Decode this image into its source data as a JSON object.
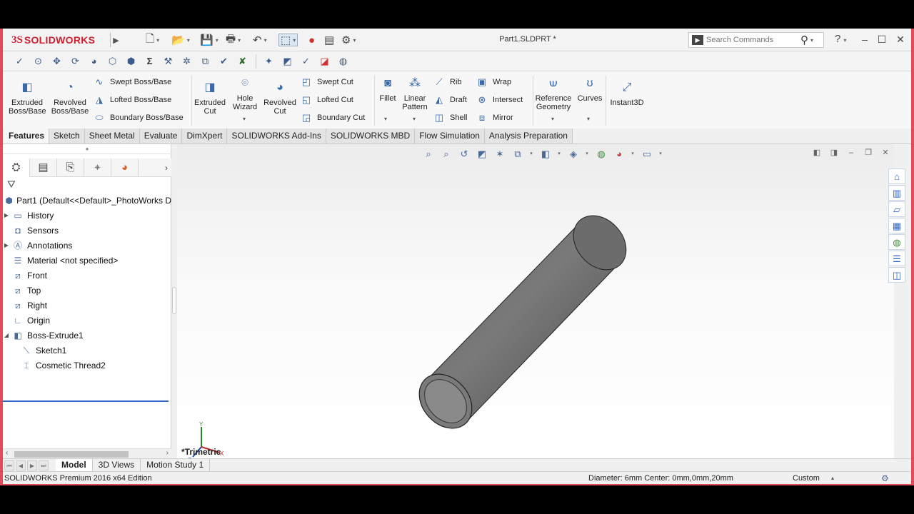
{
  "app": {
    "logo_prefix": "3S",
    "logo_text": "SOLIDWORKS",
    "document_title": "Part1.SLDPRT *",
    "search_placeholder": "Search Commands",
    "help_icon": "?",
    "window_buttons": [
      "–",
      "☐",
      "✕"
    ]
  },
  "quick_access": [
    {
      "name": "new-icon",
      "glyph": "🗋"
    },
    {
      "name": "open-icon",
      "glyph": "📂"
    },
    {
      "name": "save-icon",
      "glyph": "💾"
    },
    {
      "name": "print-icon",
      "glyph": "🖶"
    },
    {
      "name": "undo-icon",
      "glyph": "↶"
    },
    {
      "name": "select-icon",
      "glyph": "⬚"
    },
    {
      "name": "traffic-light-icon",
      "glyph": "●"
    },
    {
      "name": "options-list-icon",
      "glyph": "▤"
    },
    {
      "name": "gear-icon",
      "glyph": "⚙"
    }
  ],
  "command_manager": {
    "extruded_boss": "Extruded Boss/Base",
    "revolved_boss": "Revolved Boss/Base",
    "swept_boss": "Swept Boss/Base",
    "lofted_boss": "Lofted Boss/Base",
    "boundary_boss": "Boundary Boss/Base",
    "extruded_cut": "Extruded Cut",
    "hole_wizard": "Hole Wizard",
    "revolved_cut": "Revolved Cut",
    "swept_cut": "Swept Cut",
    "lofted_cut": "Lofted Cut",
    "boundary_cut": "Boundary Cut",
    "fillet": "Fillet",
    "linear_pattern": "Linear Pattern",
    "rib": "Rib",
    "draft": "Draft",
    "shell": "Shell",
    "wrap": "Wrap",
    "intersect": "Intersect",
    "mirror": "Mirror",
    "reference_geometry": "Reference Geometry",
    "curves": "Curves",
    "instant3d": "Instant3D"
  },
  "tabs": [
    "Features",
    "Sketch",
    "Sheet Metal",
    "Evaluate",
    "DimXpert",
    "SOLIDWORKS Add-Ins",
    "SOLIDWORKS MBD",
    "Flow Simulation",
    "Analysis Preparation"
  ],
  "tree": {
    "root": "Part1  (Default<<Default>_PhotoWorks D",
    "items": [
      {
        "label": "History",
        "icon": "history-folder-icon"
      },
      {
        "label": "Sensors",
        "icon": "sensor-icon"
      },
      {
        "label": "Annotations",
        "icon": "annotations-icon"
      },
      {
        "label": "Material <not specified>",
        "icon": "material-icon"
      },
      {
        "label": "Front",
        "icon": "plane-icon"
      },
      {
        "label": "Top",
        "icon": "plane-icon"
      },
      {
        "label": "Right",
        "icon": "plane-icon"
      },
      {
        "label": "Origin",
        "icon": "origin-icon"
      },
      {
        "label": "Boss-Extrude1",
        "icon": "extrude-feature-icon"
      },
      {
        "label": "Sketch1",
        "icon": "sketch-icon"
      },
      {
        "label": "Cosmetic Thread2",
        "icon": "cosmetic-thread-icon"
      }
    ]
  },
  "viewport": {
    "view_name": "*Trimetric",
    "triad_x": "X",
    "triad_y": "Y",
    "triad_z": "Z"
  },
  "bottom_tabs": [
    "Model",
    "3D Views",
    "Motion Study 1"
  ],
  "status": {
    "edition": "SOLIDWORKS Premium 2016 x64 Edition",
    "measurement": "Diameter: 6mm  Center: 0mm,0mm,20mm",
    "units": "Custom"
  },
  "colors": {
    "brand": "#d02030",
    "frame": "#e14b5b",
    "selection": "#2f64c8",
    "part": "#6e6e6e"
  }
}
